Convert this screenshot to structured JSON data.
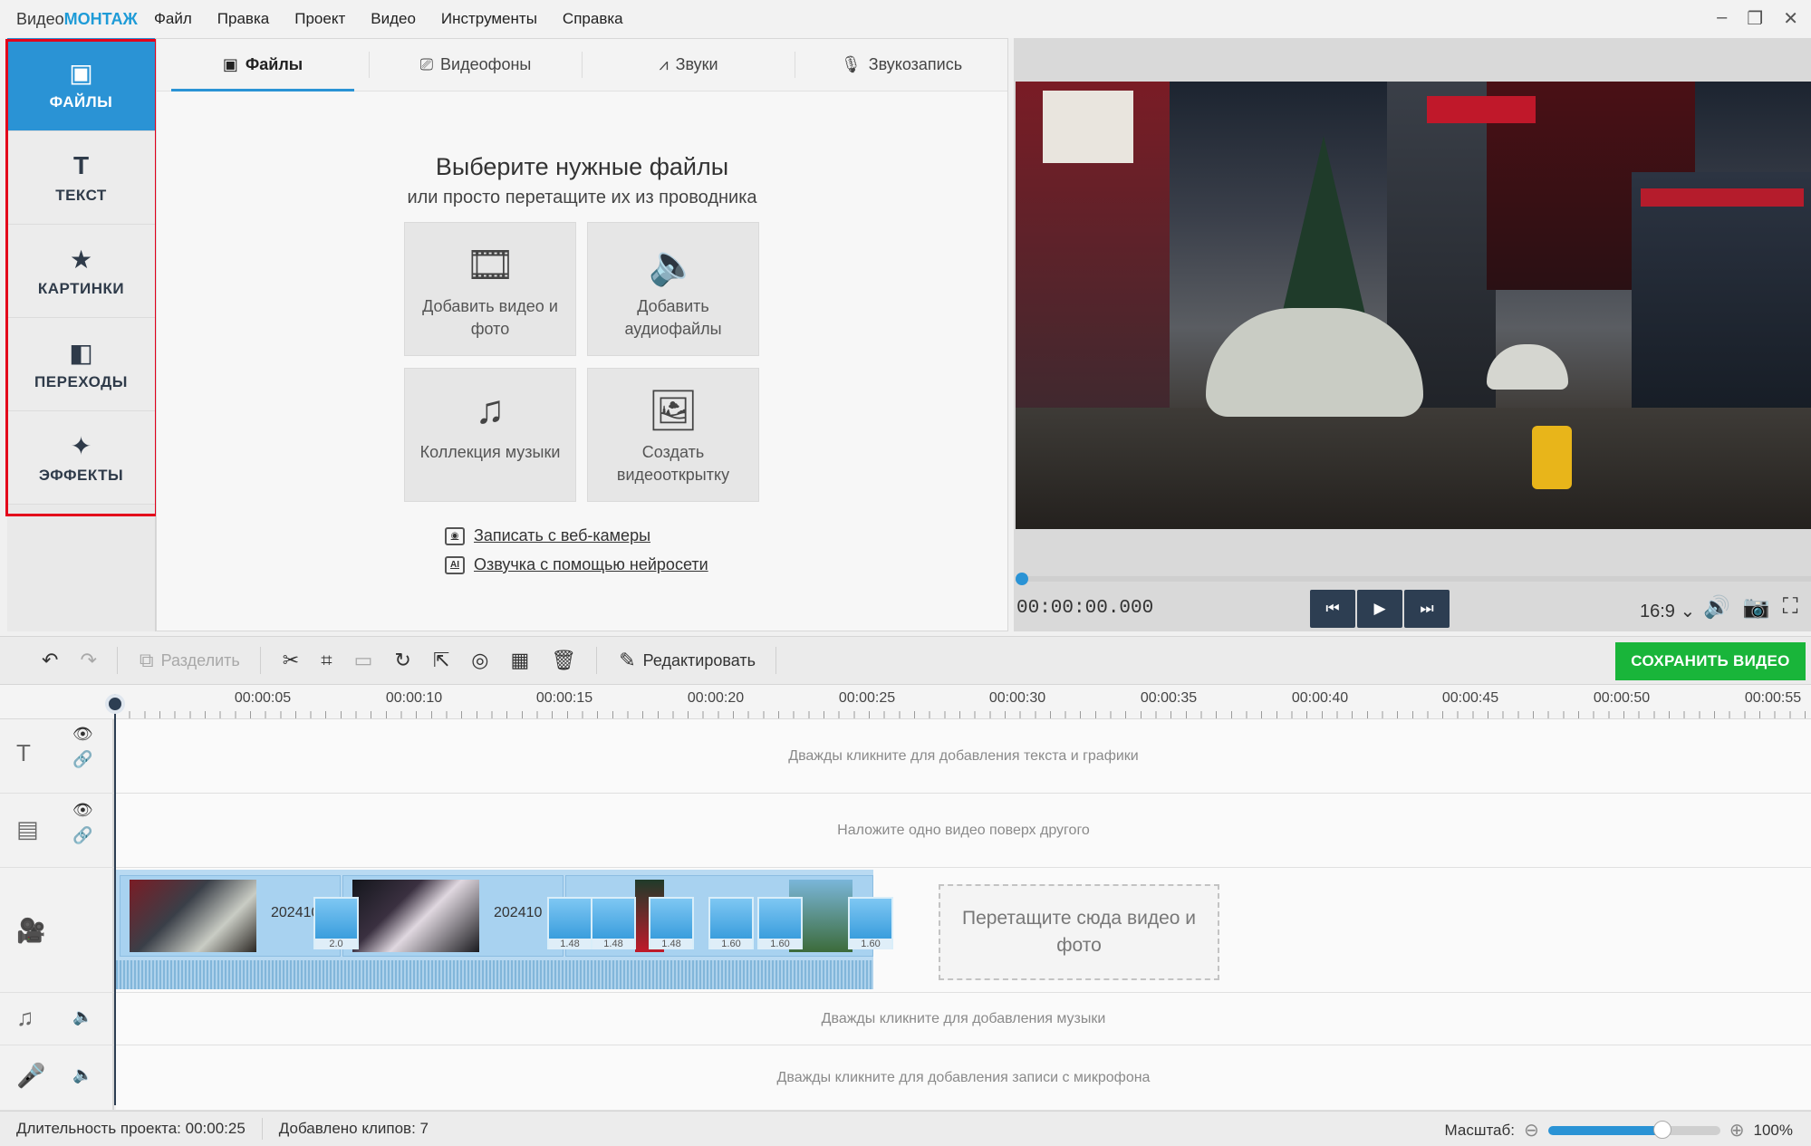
{
  "app": {
    "logo_part1": "Видео",
    "logo_part2": "МОНТАЖ"
  },
  "menu": [
    "Файл",
    "Правка",
    "Проект",
    "Видео",
    "Инструменты",
    "Справка"
  ],
  "window_controls": {
    "minimize": "–",
    "restore": "❐",
    "close": "✕"
  },
  "sidebar": {
    "items": [
      {
        "label": "ФАЙЛЫ",
        "icon": "▣",
        "active": true
      },
      {
        "label": "ТЕКСТ",
        "icon": "T"
      },
      {
        "label": "КАРТИНКИ",
        "icon": "★"
      },
      {
        "label": "ПЕРЕХОДЫ",
        "icon": "◧"
      },
      {
        "label": "ЭФФЕКТЫ",
        "icon": "✦"
      }
    ]
  },
  "files_panel": {
    "tabs": [
      {
        "label": "Файлы",
        "icon": "▣"
      },
      {
        "label": "Видеофоны",
        "icon": "⎚"
      },
      {
        "label": "Звуки",
        "icon": "⩘"
      },
      {
        "label": "Звукозапись",
        "icon": "🎙"
      }
    ],
    "heading": "Выберите нужные файлы",
    "subheading": "или просто перетащите их из проводника",
    "tiles": [
      {
        "label": "Добавить видео и фото",
        "icon": "🎞"
      },
      {
        "label": "Добавить аудиофайлы",
        "icon": "🔈"
      },
      {
        "label": "Коллекция музыки",
        "icon": "♫"
      },
      {
        "label": "Создать видеооткрытку",
        "icon": "🖼"
      }
    ],
    "links": [
      {
        "label": "Записать с веб-камеры",
        "icon": "◉"
      },
      {
        "label": "Озвучка с помощью нейросети",
        "icon": "AI"
      }
    ]
  },
  "preview": {
    "timecode": "00:00:00.000",
    "aspect_ratio": "16:9 ⌄",
    "buttons": {
      "prev": "⏮",
      "play": "▶",
      "next": "⏭"
    },
    "tools": {
      "volume": "🔊",
      "snapshot": "📷",
      "fullscreen": "⛶"
    },
    "progress": 0
  },
  "toolbar": {
    "undo": "↶",
    "redo": "↷",
    "split_label": "Разделить",
    "edit_label": "Редактировать",
    "save_label": "СОХРАНИТЬ ВИДЕО",
    "icons": {
      "split": "⧉",
      "cut": "✂",
      "crop": "⌗",
      "stop": "▭",
      "rotate": "↻",
      "resize": "⇱",
      "stabilize": "◎",
      "effects": "▦",
      "delete": "🗑",
      "edit": "✎"
    }
  },
  "timeline": {
    "ticks": [
      "00:00:05",
      "00:00:10",
      "00:00:15",
      "00:00:20",
      "00:00:25",
      "00:00:30",
      "00:00:35",
      "00:00:40",
      "00:00:45",
      "00:00:50",
      "00:00:55"
    ],
    "tracks": {
      "text_hint": "Дважды кликните для добавления текста и графики",
      "overlay_hint": "Наложите одно видео поверх другого",
      "music_hint": "Дважды кликните для добавления музыки",
      "mic_hint": "Дважды кликните для добавления записи с микрофона"
    },
    "track_icons": {
      "text": "T",
      "overlay": "▤",
      "video": "🎥",
      "music": "♫",
      "mic": "🎤",
      "eye": "👁",
      "link": "🔗",
      "speaker": "🔈"
    },
    "clips": [
      {
        "name": "202410"
      },
      {
        "name": "202410"
      }
    ],
    "transitions": [
      "2.0",
      "1.48",
      "1.48",
      "1.48",
      "1.60",
      "1.60",
      "1.60"
    ],
    "drop_zone": "Перетащите сюда видео и фото"
  },
  "statusbar": {
    "duration_label": "Длительность проекта:",
    "duration": "00:00:25",
    "clips_label": "Добавлено клипов:",
    "clips_count": "7",
    "scale_label": "Масштаб:",
    "zoom_out": "⊖",
    "zoom_in": "⊕",
    "scale_value": "100%",
    "zoom_level": 0.64
  }
}
